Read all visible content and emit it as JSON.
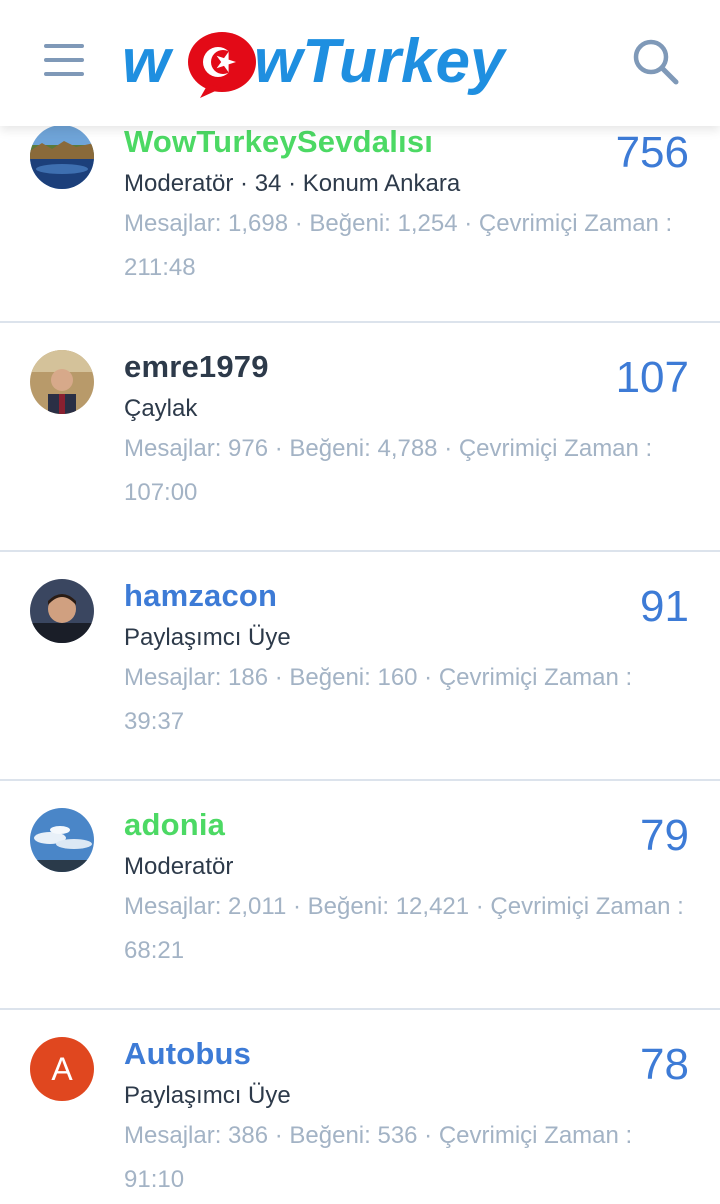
{
  "header": {
    "menu_icon": "hamburger-menu-icon",
    "logo_text_left": "w",
    "logo_text_right": "wTurkey",
    "search_icon": "search-icon"
  },
  "colors": {
    "brand_blue": "#1f8fe0",
    "flag_red": "#e30a17",
    "moderator_green": "#4cd964",
    "member_blue": "#3d7bd6",
    "default_name": "#2d3a4a",
    "stats_gray": "#a3b3c5",
    "count_blue": "#3d7bd6"
  },
  "members": [
    {
      "name": "WowTurkeySevdalısı",
      "role": "Moderatör · 34 · Konum Ankara",
      "stats": "Mesajlar: 1,698 · Beğeni: 1,254 · Çevrimiçi Zaman : 211:48",
      "count": "756",
      "name_color": "#4cd964",
      "avatar": "landscape-lake-photo"
    },
    {
      "name": "emre1979",
      "role": "Çaylak",
      "stats": "Mesajlar: 976 · Beğeni: 4,788 · Çevrimiçi Zaman : 107:00",
      "count": "107",
      "name_color": "#2d3a4a",
      "avatar": "man-in-suit-photo"
    },
    {
      "name": "hamzacon",
      "role": "Paylaşımcı Üye",
      "stats": "Mesajlar: 186 · Beğeni: 160 · Çevrimiçi Zaman : 39:37",
      "count": "91",
      "name_color": "#3d7bd6",
      "avatar": "man-portrait-photo"
    },
    {
      "name": "adonia",
      "role": "Moderatör",
      "stats": "Mesajlar: 2,011 · Beğeni: 12,421 · Çevrimiçi Zaman : 68:21",
      "count": "79",
      "name_color": "#4cd964",
      "avatar": "sky-clouds-photo"
    },
    {
      "name": "Autobus",
      "role": "Paylaşımcı Üye",
      "stats": "Mesajlar: 386 · Beğeni: 536 · Çevrimiçi Zaman : 91:10",
      "count": "78",
      "name_color": "#3d7bd6",
      "avatar": "letter-avatar",
      "avatar_letter": "A"
    }
  ]
}
